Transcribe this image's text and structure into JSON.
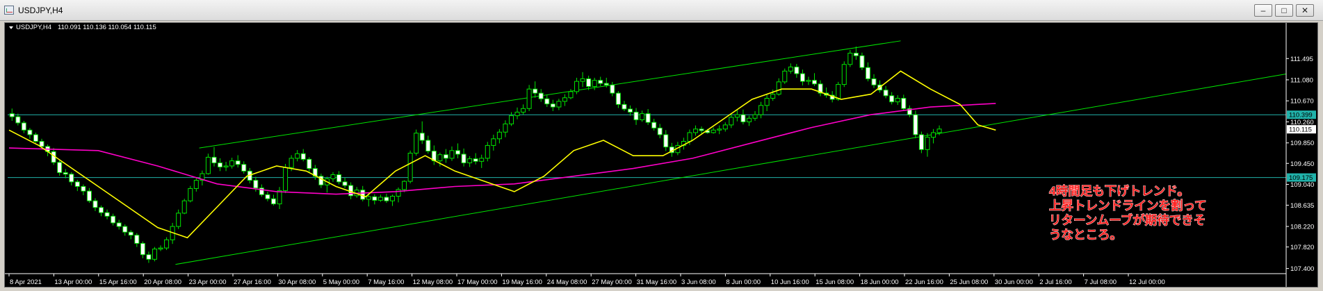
{
  "window": {
    "title": "USDJPY,H4",
    "buttons": {
      "minimize": "–",
      "maximize": "□",
      "close": "✕"
    }
  },
  "chart_data": {
    "type": "candlestick",
    "symbol_label": "USDJPY,H4",
    "ohlc_readout": "110.091 110.136 110.054 110.115",
    "current_price": 110.115,
    "ylim": [
      107.3,
      112.0
    ],
    "y_ticks": [
      "111.495",
      "111.080",
      "110.670",
      "110.260",
      "109.850",
      "109.450",
      "109.040",
      "108.635",
      "108.220",
      "107.820",
      "107.400"
    ],
    "x_ticks": [
      "8 Apr 2021",
      "13 Apr 00:00",
      "15 Apr 16:00",
      "20 Apr 08:00",
      "23 Apr 00:00",
      "27 Apr 16:00",
      "30 Apr 08:00",
      "5 May 00:00",
      "7 May 16:00",
      "12 May 08:00",
      "17 May 00:00",
      "19 May 16:00",
      "24 May 08:00",
      "27 May 00:00",
      "31 May 16:00",
      "3 Jun 08:00",
      "8 Jun 00:00",
      "10 Jun 16:00",
      "15 Jun 08:00",
      "18 Jun 00:00",
      "22 Jun 16:00",
      "25 Jun 08:00",
      "30 Jun 00:00",
      "2 Jul 16:00",
      "7 Jul 08:00",
      "12 Jul 00:00"
    ],
    "horizontal_levels": [
      {
        "price": 110.399,
        "label": "110.399",
        "color": "#20b2aa"
      },
      {
        "price": 109.175,
        "label": "109.175",
        "color": "#20b2aa"
      }
    ],
    "trendlines": [
      {
        "name": "channel-upper",
        "from": {
          "t": 32,
          "price": 109.75
        },
        "to": {
          "t": 150,
          "price": 111.84
        },
        "color": "#00e600"
      },
      {
        "name": "channel-lower",
        "from": {
          "t": 28,
          "price": 107.48
        },
        "to": {
          "t": 190,
          "price": 110.7
        },
        "color": "#00e600"
      }
    ],
    "fast_ma": {
      "color": "#ffff00",
      "points": [
        [
          0,
          110.1
        ],
        [
          5,
          109.8
        ],
        [
          10,
          109.4
        ],
        [
          15,
          109.0
        ],
        [
          20,
          108.6
        ],
        [
          25,
          108.2
        ],
        [
          30,
          108.0
        ],
        [
          35,
          108.6
        ],
        [
          40,
          109.2
        ],
        [
          45,
          109.4
        ],
        [
          50,
          109.3
        ],
        [
          55,
          109.0
        ],
        [
          60,
          108.8
        ],
        [
          65,
          109.3
        ],
        [
          70,
          109.6
        ],
        [
          75,
          109.3
        ],
        [
          80,
          109.1
        ],
        [
          85,
          108.9
        ],
        [
          90,
          109.2
        ],
        [
          95,
          109.7
        ],
        [
          100,
          109.9
        ],
        [
          105,
          109.6
        ],
        [
          110,
          109.6
        ],
        [
          115,
          109.9
        ],
        [
          120,
          110.3
        ],
        [
          125,
          110.7
        ],
        [
          130,
          110.9
        ],
        [
          135,
          110.9
        ],
        [
          140,
          110.7
        ],
        [
          145,
          110.8
        ],
        [
          150,
          111.25
        ],
        [
          155,
          110.9
        ],
        [
          160,
          110.6
        ],
        [
          163,
          110.2
        ],
        [
          166,
          110.1
        ]
      ]
    },
    "slow_ma": {
      "color": "#ff00c8",
      "points": [
        [
          0,
          109.75
        ],
        [
          15,
          109.7
        ],
        [
          25,
          109.4
        ],
        [
          35,
          109.05
        ],
        [
          45,
          108.9
        ],
        [
          55,
          108.85
        ],
        [
          65,
          108.9
        ],
        [
          75,
          109.0
        ],
        [
          85,
          109.05
        ],
        [
          95,
          109.2
        ],
        [
          105,
          109.35
        ],
        [
          115,
          109.55
        ],
        [
          125,
          109.85
        ],
        [
          135,
          110.15
        ],
        [
          145,
          110.4
        ],
        [
          155,
          110.55
        ],
        [
          166,
          110.62
        ]
      ]
    },
    "candles": [
      [
        110.42,
        110.52,
        110.28,
        110.36
      ],
      [
        110.36,
        110.42,
        110.19,
        110.24
      ],
      [
        110.24,
        110.28,
        110.04,
        110.1
      ],
      [
        110.1,
        110.14,
        109.93,
        110.01
      ],
      [
        110.01,
        110.05,
        109.85,
        109.88
      ],
      [
        109.88,
        109.93,
        109.73,
        109.78
      ],
      [
        109.78,
        109.82,
        109.59,
        109.68
      ],
      [
        109.68,
        109.75,
        109.42,
        109.47
      ],
      [
        109.47,
        109.51,
        109.21,
        109.27
      ],
      [
        109.27,
        109.34,
        109.16,
        109.24
      ],
      [
        109.24,
        109.28,
        109.02,
        109.09
      ],
      [
        109.09,
        109.13,
        108.91,
        109.0
      ],
      [
        109.0,
        109.04,
        108.83,
        108.91
      ],
      [
        108.91,
        108.97,
        108.68,
        108.72
      ],
      [
        108.72,
        108.77,
        108.52,
        108.59
      ],
      [
        108.59,
        108.63,
        108.42,
        108.49
      ],
      [
        108.49,
        108.55,
        108.36,
        108.42
      ],
      [
        108.42,
        108.47,
        108.24,
        108.29
      ],
      [
        108.29,
        108.35,
        108.16,
        108.22
      ],
      [
        108.22,
        108.26,
        108.04,
        108.11
      ],
      [
        108.11,
        108.15,
        107.97,
        108.05
      ],
      [
        108.05,
        108.09,
        107.82,
        107.89
      ],
      [
        107.89,
        107.93,
        107.6,
        107.67
      ],
      [
        107.67,
        107.73,
        107.51,
        107.58
      ],
      [
        107.58,
        107.82,
        107.54,
        107.78
      ],
      [
        107.78,
        107.85,
        107.74,
        107.8
      ],
      [
        107.8,
        108.01,
        107.76,
        107.96
      ],
      [
        107.96,
        108.29,
        107.88,
        108.22
      ],
      [
        108.22,
        108.55,
        108.17,
        108.48
      ],
      [
        108.48,
        108.76,
        108.46,
        108.72
      ],
      [
        108.72,
        109.01,
        108.69,
        108.96
      ],
      [
        108.96,
        109.18,
        108.9,
        109.12
      ],
      [
        109.12,
        109.31,
        109.02,
        109.25
      ],
      [
        109.25,
        109.64,
        109.23,
        109.57
      ],
      [
        109.57,
        109.77,
        109.39,
        109.46
      ],
      [
        109.46,
        109.55,
        109.3,
        109.38
      ],
      [
        109.38,
        109.48,
        109.3,
        109.4
      ],
      [
        109.4,
        109.56,
        109.35,
        109.5
      ],
      [
        109.5,
        109.61,
        109.37,
        109.43
      ],
      [
        109.43,
        109.49,
        109.25,
        109.3
      ],
      [
        109.3,
        109.36,
        109.06,
        109.12
      ],
      [
        109.12,
        109.19,
        108.9,
        108.97
      ],
      [
        108.97,
        109.04,
        108.8,
        108.84
      ],
      [
        108.84,
        108.9,
        108.71,
        108.76
      ],
      [
        108.76,
        108.84,
        108.63,
        108.66
      ],
      [
        108.66,
        108.99,
        108.56,
        108.92
      ],
      [
        108.92,
        109.44,
        108.87,
        109.37
      ],
      [
        109.37,
        109.61,
        109.3,
        109.55
      ],
      [
        109.55,
        109.71,
        109.49,
        109.64
      ],
      [
        109.64,
        109.73,
        109.49,
        109.53
      ],
      [
        109.53,
        109.57,
        109.27,
        109.35
      ],
      [
        109.35,
        109.42,
        109.13,
        109.2
      ],
      [
        109.2,
        109.25,
        108.97,
        109.03
      ],
      [
        109.03,
        109.19,
        108.88,
        109.15
      ],
      [
        109.15,
        109.28,
        109.09,
        109.23
      ],
      [
        109.23,
        109.3,
        109.04,
        109.09
      ],
      [
        109.09,
        109.17,
        108.97,
        109.02
      ],
      [
        109.02,
        109.08,
        108.75,
        108.82
      ],
      [
        108.82,
        108.99,
        108.78,
        108.93
      ],
      [
        108.93,
        109.01,
        108.71,
        108.75
      ],
      [
        108.75,
        108.86,
        108.61,
        108.8
      ],
      [
        108.8,
        108.85,
        108.65,
        108.73
      ],
      [
        108.73,
        108.84,
        108.7,
        108.79
      ],
      [
        108.79,
        108.86,
        108.68,
        108.72
      ],
      [
        108.72,
        108.84,
        108.62,
        108.81
      ],
      [
        108.81,
        108.98,
        108.69,
        108.94
      ],
      [
        108.94,
        109.12,
        108.89,
        109.1
      ],
      [
        109.1,
        109.7,
        109.06,
        109.65
      ],
      [
        109.65,
        110.11,
        109.6,
        110.04
      ],
      [
        110.04,
        110.27,
        109.83,
        109.9
      ],
      [
        109.9,
        109.99,
        109.64,
        109.69
      ],
      [
        109.69,
        109.8,
        109.42,
        109.5
      ],
      [
        109.5,
        109.66,
        109.39,
        109.62
      ],
      [
        109.62,
        109.73,
        109.46,
        109.55
      ],
      [
        109.55,
        109.78,
        109.5,
        109.7
      ],
      [
        109.7,
        109.84,
        109.55,
        109.63
      ],
      [
        109.63,
        109.74,
        109.39,
        109.46
      ],
      [
        109.46,
        109.59,
        109.38,
        109.54
      ],
      [
        109.54,
        109.65,
        109.43,
        109.49
      ],
      [
        109.49,
        109.62,
        109.36,
        109.55
      ],
      [
        109.55,
        109.87,
        109.49,
        109.8
      ],
      [
        109.8,
        110.01,
        109.7,
        109.93
      ],
      [
        109.93,
        110.12,
        109.84,
        110.06
      ],
      [
        110.06,
        110.29,
        109.96,
        110.22
      ],
      [
        110.22,
        110.45,
        110.18,
        110.38
      ],
      [
        110.38,
        110.54,
        110.31,
        110.45
      ],
      [
        110.45,
        110.6,
        110.4,
        110.52
      ],
      [
        110.52,
        110.98,
        110.47,
        110.9
      ],
      [
        110.9,
        111.05,
        110.73,
        110.82
      ],
      [
        110.82,
        110.9,
        110.65,
        110.71
      ],
      [
        110.71,
        110.79,
        110.55,
        110.61
      ],
      [
        110.61,
        110.69,
        110.47,
        110.55
      ],
      [
        110.55,
        110.71,
        110.49,
        110.66
      ],
      [
        110.66,
        110.8,
        110.57,
        110.73
      ],
      [
        110.73,
        110.9,
        110.7,
        110.85
      ],
      [
        110.85,
        111.12,
        110.8,
        111.05
      ],
      [
        111.05,
        111.23,
        110.94,
        111.1
      ],
      [
        111.1,
        111.16,
        110.88,
        110.95
      ],
      [
        110.95,
        111.12,
        110.88,
        111.07
      ],
      [
        111.07,
        111.14,
        110.96,
        111.01
      ],
      [
        111.01,
        111.12,
        110.93,
        110.98
      ],
      [
        110.98,
        111.04,
        110.76,
        110.82
      ],
      [
        110.82,
        110.86,
        110.53,
        110.6
      ],
      [
        110.6,
        110.67,
        110.47,
        110.51
      ],
      [
        110.51,
        110.58,
        110.38,
        110.45
      ],
      [
        110.45,
        110.53,
        110.2,
        110.3
      ],
      [
        110.3,
        110.48,
        110.26,
        110.42
      ],
      [
        110.42,
        110.51,
        110.2,
        110.25
      ],
      [
        110.25,
        110.32,
        110.09,
        110.14
      ],
      [
        110.14,
        110.22,
        109.94,
        110.01
      ],
      [
        110.01,
        110.1,
        109.69,
        109.77
      ],
      [
        109.77,
        109.85,
        109.58,
        109.66
      ],
      [
        109.66,
        109.87,
        109.61,
        109.8
      ],
      [
        109.8,
        109.95,
        109.72,
        109.88
      ],
      [
        109.88,
        110.11,
        109.81,
        110.05
      ],
      [
        110.05,
        110.19,
        109.99,
        110.12
      ],
      [
        110.12,
        110.17,
        110.03,
        110.09
      ],
      [
        110.09,
        110.12,
        110.03,
        110.05
      ],
      [
        110.05,
        110.15,
        110.03,
        110.1
      ],
      [
        110.1,
        110.19,
        110.02,
        110.12
      ],
      [
        110.12,
        110.25,
        110.07,
        110.2
      ],
      [
        110.2,
        110.42,
        110.14,
        110.35
      ],
      [
        110.35,
        110.49,
        110.27,
        110.4
      ],
      [
        110.4,
        110.5,
        110.21,
        110.26
      ],
      [
        110.26,
        110.38,
        110.18,
        110.33
      ],
      [
        110.33,
        110.47,
        110.28,
        110.4
      ],
      [
        110.4,
        110.65,
        110.33,
        110.58
      ],
      [
        110.58,
        110.79,
        110.47,
        110.72
      ],
      [
        110.72,
        110.89,
        110.67,
        110.8
      ],
      [
        110.8,
        111.11,
        110.77,
        111.04
      ],
      [
        111.04,
        111.3,
        111.0,
        111.25
      ],
      [
        111.25,
        111.4,
        111.2,
        111.33
      ],
      [
        111.33,
        111.39,
        111.12,
        111.2
      ],
      [
        111.2,
        111.28,
        110.97,
        111.05
      ],
      [
        111.05,
        111.14,
        110.98,
        111.07
      ],
      [
        111.07,
        111.21,
        110.96,
        111.0
      ],
      [
        111.0,
        111.07,
        110.76,
        110.82
      ],
      [
        110.82,
        110.93,
        110.73,
        110.78
      ],
      [
        110.78,
        110.86,
        110.64,
        110.7
      ],
      [
        110.7,
        111.04,
        110.67,
        110.99
      ],
      [
        110.99,
        111.44,
        110.94,
        111.38
      ],
      [
        111.38,
        111.66,
        111.33,
        111.6
      ],
      [
        111.6,
        111.73,
        111.47,
        111.55
      ],
      [
        111.55,
        111.61,
        111.27,
        111.32
      ],
      [
        111.32,
        111.42,
        111.05,
        111.1
      ],
      [
        111.1,
        111.19,
        110.92,
        110.98
      ],
      [
        110.98,
        111.07,
        110.83,
        110.88
      ],
      [
        110.88,
        110.96,
        110.72,
        110.77
      ],
      [
        110.77,
        110.84,
        110.6,
        110.65
      ],
      [
        110.65,
        110.78,
        110.59,
        110.72
      ],
      [
        110.72,
        110.79,
        110.47,
        110.52
      ],
      [
        110.52,
        110.58,
        110.35,
        110.4
      ],
      [
        110.4,
        110.48,
        109.94,
        110.01
      ],
      [
        110.01,
        110.07,
        109.65,
        109.72
      ],
      [
        109.72,
        110.04,
        109.58,
        109.96
      ],
      [
        109.96,
        110.12,
        109.84,
        110.05
      ],
      [
        110.05,
        110.19,
        110.0,
        110.12
      ]
    ]
  },
  "annotation": {
    "text_lines": [
      "4時間足も下げトレンド。",
      "上昇トレンドラインを割って",
      "リターンムーブが期待できそ",
      "うなところ。"
    ],
    "color": "#ff2020"
  }
}
